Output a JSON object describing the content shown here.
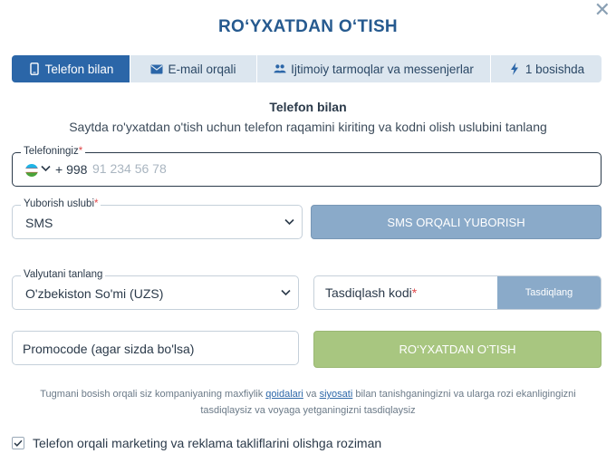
{
  "title": "RO‘YXATDAN O‘TISH",
  "close_icon": "close-icon",
  "tabs": [
    {
      "label": "Telefon bilan",
      "icon": "phone-icon",
      "active": true
    },
    {
      "label": "E-mail orqali",
      "icon": "envelope-icon",
      "active": false
    },
    {
      "label": "Ijtimoiy tarmoqlar va messenjerlar",
      "icon": "users-icon",
      "active": false
    },
    {
      "label": "1 bosishda",
      "icon": "lightning-icon",
      "active": false
    }
  ],
  "section": {
    "title": "Telefon bilan",
    "description": "Saytda ro'yxatdan o'tish uchun telefon raqamini kiriting va kodni olish uslubini tanlang"
  },
  "phone": {
    "label": "Telefoningiz",
    "country_code": "+ 998",
    "placeholder": "91 234 56 78",
    "flag_icon": "uzbekistan-flag-icon"
  },
  "send_method": {
    "label": "Yuborish uslubi",
    "value": "SMS"
  },
  "sms_button": "SMS ORQALI YUBORISH",
  "currency": {
    "label": "Valyutani tanlang",
    "value": "O'zbekiston So'mi (UZS)"
  },
  "confirm": {
    "placeholder": "Tasdiqlash kodi",
    "button": "Tasdiqlang"
  },
  "promo": {
    "placeholder": "Promocode (agar sizda bo'lsa)"
  },
  "register_button": "RO‘YXATDAN O‘TISH",
  "legal": {
    "part1": "Tugmani bosish orqali siz kompaniyaning maxfiylik ",
    "link1": "qoidalari",
    "part2": " va ",
    "link2": "siyosati",
    "part3": " bilan tanishganingizni va ularga rozi ekanligingizni tasdiqlaysiz va voyaga yetganingizni tasdiqlaysiz"
  },
  "marketing_consent": {
    "label": "Telefon orqali marketing va reklama takliflarini olishga roziman",
    "checked": true
  },
  "colors": {
    "primary": "#2b66a8",
    "title": "#265a8f",
    "sms_button": "#8aaac9",
    "register_button": "#a8c680"
  }
}
